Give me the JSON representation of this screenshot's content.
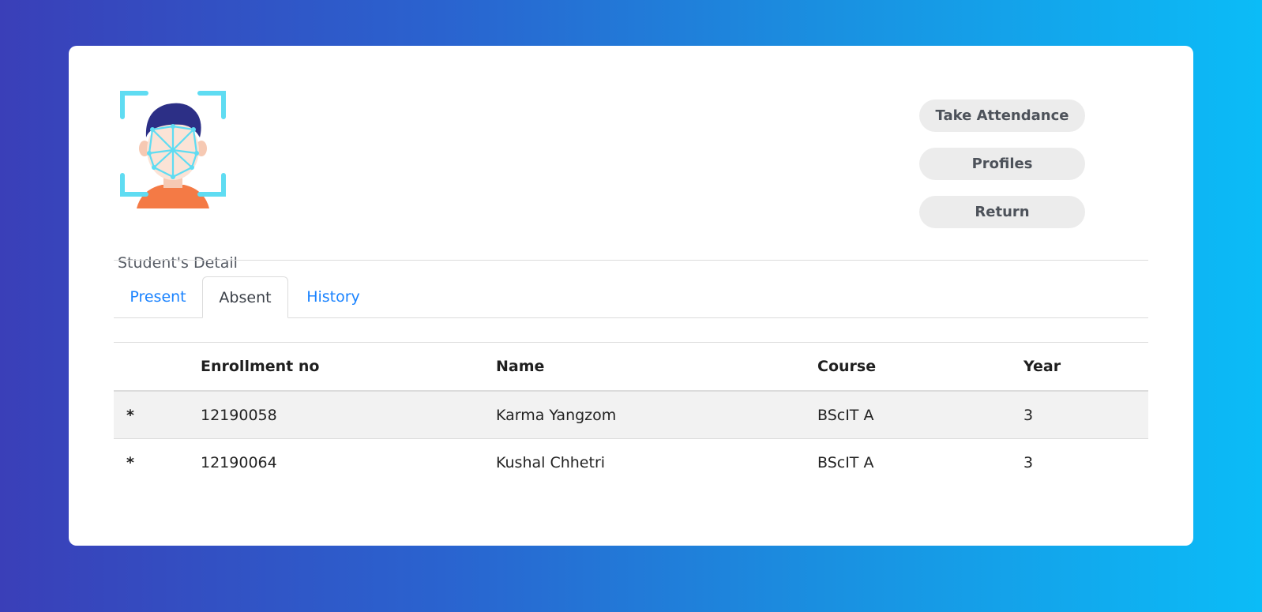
{
  "header": {
    "logo_icon": "face-scan-icon",
    "caption": "Student's Detail"
  },
  "actions": {
    "take_attendance": "Take Attendance",
    "profiles": "Profiles",
    "return": "Return"
  },
  "tabs": [
    {
      "label": "Present",
      "active": false
    },
    {
      "label": "Absent",
      "active": true
    },
    {
      "label": "History",
      "active": false
    }
  ],
  "table": {
    "columns": [
      "",
      "Enrollment no",
      "Name",
      "Course",
      "Year"
    ],
    "rows": [
      {
        "marker": "*",
        "enrollment": "12190058",
        "name": "Karma Yangzom",
        "course": "BScIT A",
        "year": "3"
      },
      {
        "marker": "*",
        "enrollment": "12190064",
        "name": "Kushal Chhetri",
        "course": "BScIT A",
        "year": "3"
      }
    ]
  },
  "colors": {
    "tab_link": "#1a83ff",
    "button_bg": "#ececec",
    "gradient_start": "#3a3fb8",
    "gradient_end": "#0bbcf7"
  }
}
